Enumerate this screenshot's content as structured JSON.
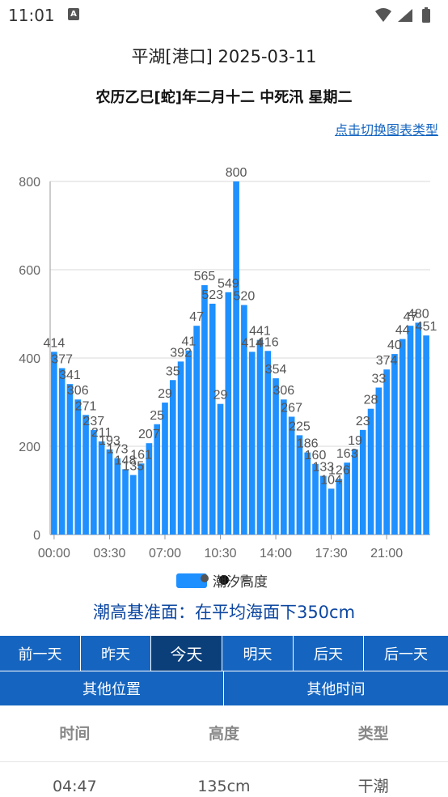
{
  "status": {
    "time": "11:01",
    "app_badge": "A"
  },
  "header": {
    "title": "平湖[港口]  2025-03-11",
    "subtitle": "农历乙巳[蛇]年二月十二  中死汛  星期二",
    "switch_link": "点击切换图表类型"
  },
  "chart_data": {
    "type": "bar",
    "color": "#1e90ff",
    "ylim": [
      0,
      800
    ],
    "yticks": [
      "0",
      "200",
      "400",
      "600",
      "800"
    ],
    "xticks": [
      "00:00",
      "03:30",
      "07:00",
      "10:30",
      "14:00",
      "17:30",
      "21:00"
    ],
    "legend": "潮汐高度",
    "values": [
      414,
      377,
      341,
      306,
      271,
      237,
      211,
      193,
      173,
      148,
      135,
      161,
      207,
      250,
      299,
      350,
      392,
      417,
      473,
      565,
      523,
      296,
      549,
      800,
      520,
      414,
      441,
      416,
      354,
      306,
      267,
      225,
      186,
      160,
      133,
      104,
      126,
      163,
      193,
      237,
      285,
      333,
      374,
      409,
      443,
      473,
      480,
      451
    ],
    "labels": [
      "414",
      "377",
      "341",
      "306",
      "271",
      "237",
      "211",
      "193",
      "173",
      "148",
      "135",
      "161",
      "207",
      "25",
      "29",
      "35",
      "392",
      "41",
      "47",
      "565",
      "523",
      "29",
      "549",
      "800",
      "520",
      "414",
      "441",
      "416",
      "354",
      "306",
      "267",
      "225",
      "186",
      "160",
      "133",
      "104",
      "126",
      "163",
      "19",
      "23",
      "28",
      "33",
      "374",
      "40",
      "44",
      "47",
      "480",
      "451"
    ]
  },
  "datum": "潮高基准面：在平均海面下350cm",
  "day_buttons": [
    "前一天",
    "昨天",
    "今天",
    "明天",
    "后天",
    "后一天"
  ],
  "active_day": "今天",
  "options": {
    "location": "其他位置",
    "time": "其他时间"
  },
  "table": {
    "headers": [
      "时间",
      "高度",
      "类型"
    ],
    "rows": [
      {
        "time": "04:47",
        "height": "135cm",
        "type": "干潮"
      }
    ]
  }
}
